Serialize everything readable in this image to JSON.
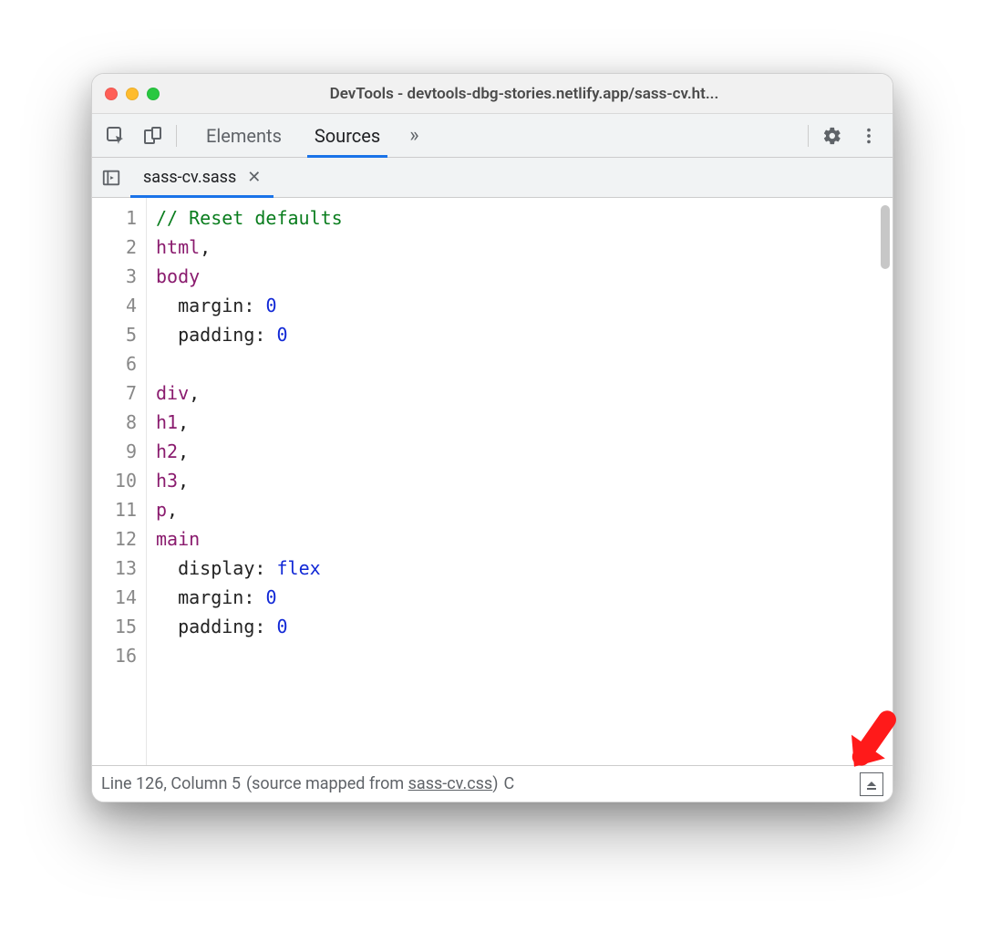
{
  "window": {
    "title": "DevTools - devtools-dbg-stories.netlify.app/sass-cv.ht..."
  },
  "toolbar": {
    "tabs": [
      {
        "label": "Elements",
        "active": false
      },
      {
        "label": "Sources",
        "active": true
      }
    ]
  },
  "file_tab": {
    "label": "sass-cv.sass"
  },
  "editor": {
    "lines": [
      {
        "n": 1,
        "tokens": [
          {
            "cls": "tok-comment",
            "t": "// Reset defaults"
          }
        ]
      },
      {
        "n": 2,
        "tokens": [
          {
            "cls": "tok-selector",
            "t": "html"
          },
          {
            "cls": "tok-punc",
            "t": ","
          }
        ]
      },
      {
        "n": 3,
        "tokens": [
          {
            "cls": "tok-selector",
            "t": "body"
          }
        ]
      },
      {
        "n": 4,
        "tokens": [
          {
            "cls": "",
            "t": "  "
          },
          {
            "cls": "tok-prop",
            "t": "margin"
          },
          {
            "cls": "tok-punc",
            "t": ": "
          },
          {
            "cls": "tok-val",
            "t": "0"
          }
        ]
      },
      {
        "n": 5,
        "tokens": [
          {
            "cls": "",
            "t": "  "
          },
          {
            "cls": "tok-prop",
            "t": "padding"
          },
          {
            "cls": "tok-punc",
            "t": ": "
          },
          {
            "cls": "tok-val",
            "t": "0"
          }
        ]
      },
      {
        "n": 6,
        "tokens": [
          {
            "cls": "",
            "t": ""
          }
        ]
      },
      {
        "n": 7,
        "tokens": [
          {
            "cls": "tok-selector",
            "t": "div"
          },
          {
            "cls": "tok-punc",
            "t": ","
          }
        ]
      },
      {
        "n": 8,
        "tokens": [
          {
            "cls": "tok-selector",
            "t": "h1"
          },
          {
            "cls": "tok-punc",
            "t": ","
          }
        ]
      },
      {
        "n": 9,
        "tokens": [
          {
            "cls": "tok-selector",
            "t": "h2"
          },
          {
            "cls": "tok-punc",
            "t": ","
          }
        ]
      },
      {
        "n": 10,
        "tokens": [
          {
            "cls": "tok-selector",
            "t": "h3"
          },
          {
            "cls": "tok-punc",
            "t": ","
          }
        ]
      },
      {
        "n": 11,
        "tokens": [
          {
            "cls": "tok-selector",
            "t": "p"
          },
          {
            "cls": "tok-punc",
            "t": ","
          }
        ]
      },
      {
        "n": 12,
        "tokens": [
          {
            "cls": "tok-selector",
            "t": "main"
          }
        ]
      },
      {
        "n": 13,
        "tokens": [
          {
            "cls": "",
            "t": "  "
          },
          {
            "cls": "tok-prop",
            "t": "display"
          },
          {
            "cls": "tok-punc",
            "t": ": "
          },
          {
            "cls": "tok-val",
            "t": "flex"
          }
        ]
      },
      {
        "n": 14,
        "tokens": [
          {
            "cls": "",
            "t": "  "
          },
          {
            "cls": "tok-prop",
            "t": "margin"
          },
          {
            "cls": "tok-punc",
            "t": ": "
          },
          {
            "cls": "tok-val",
            "t": "0"
          }
        ]
      },
      {
        "n": 15,
        "tokens": [
          {
            "cls": "",
            "t": "  "
          },
          {
            "cls": "tok-prop",
            "t": "padding"
          },
          {
            "cls": "tok-punc",
            "t": ": "
          },
          {
            "cls": "tok-val",
            "t": "0"
          }
        ]
      },
      {
        "n": 16,
        "tokens": [
          {
            "cls": "",
            "t": ""
          }
        ]
      }
    ]
  },
  "status": {
    "position": "Line 126, Column 5",
    "mapped_prefix": "(source mapped from ",
    "mapped_link": "sass-cv.css",
    "mapped_suffix": ")",
    "trailing": "C"
  }
}
